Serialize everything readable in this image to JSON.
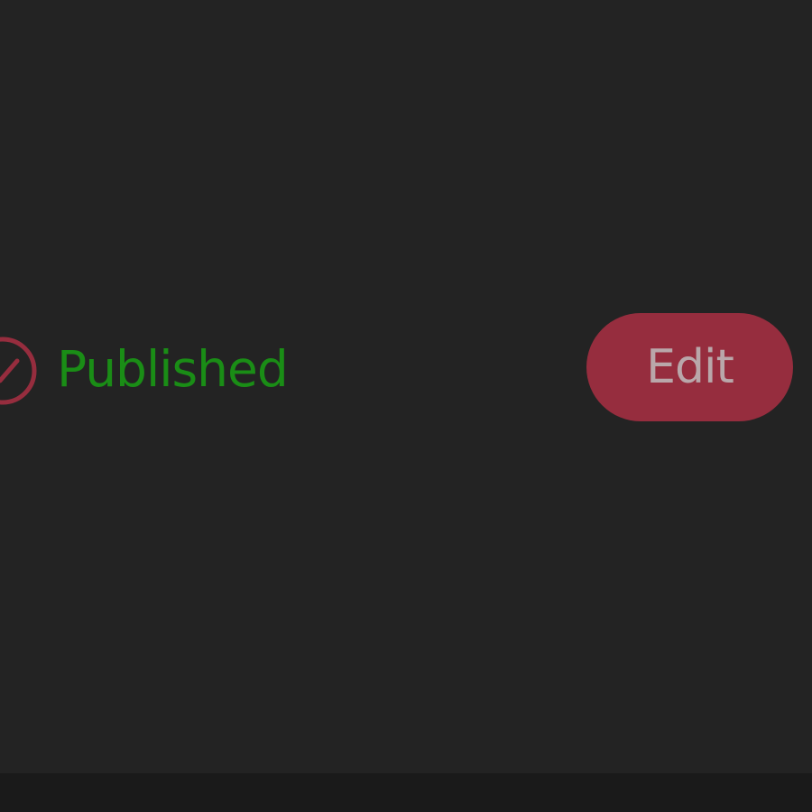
{
  "status": {
    "label": "Published",
    "icon": "check-circle-icon",
    "text_color": "#1a8d16",
    "icon_color": "#962d3e"
  },
  "actions": {
    "edit_label": "Edit",
    "edit_bg": "#962d3e"
  },
  "theme": {
    "background": "#232323",
    "footer_background": "#1a1a1a"
  }
}
